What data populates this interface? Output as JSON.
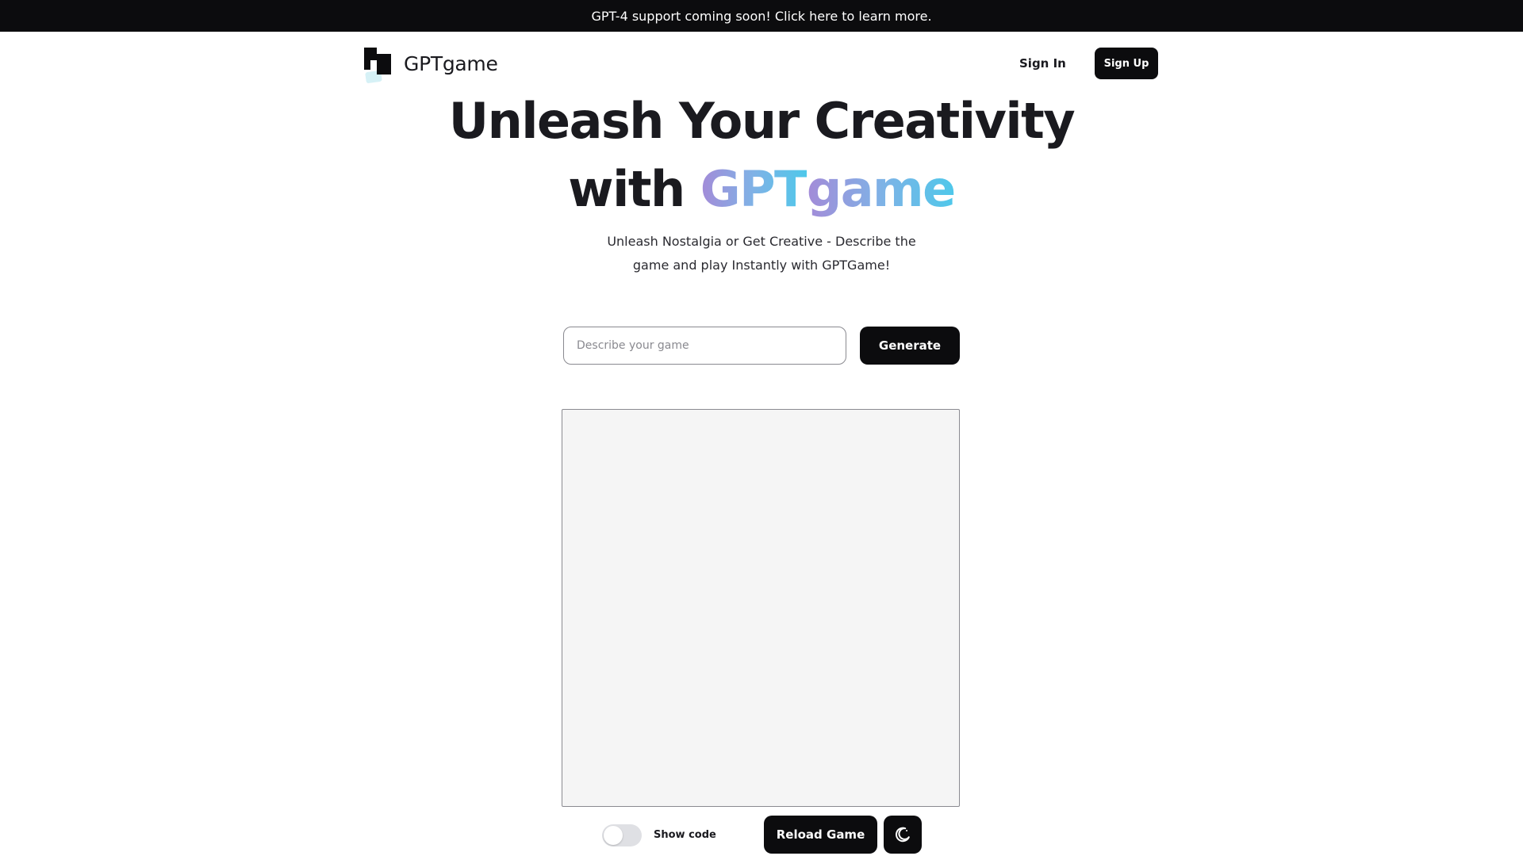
{
  "announcement": {
    "text": "GPT-4 support coming soon! Click here to learn more."
  },
  "header": {
    "brand": "GPTgame",
    "signin_label": "Sign In",
    "signup_label": "Sign Up"
  },
  "hero": {
    "line1": "Unleash Your Creativity",
    "line2_prefix": "with ",
    "gradient_part1": "GPT",
    "gradient_part2": "game",
    "subtitle": "Unleash Nostalgia or Get Creative - Describe the game and play Instantly with GPTGame!",
    "gradient_colors": [
      "#a38bd8",
      "#7fb2e6",
      "#4ec8ea"
    ]
  },
  "prompt": {
    "placeholder": "Describe your game",
    "value": "",
    "generate_label": "Generate"
  },
  "controls": {
    "show_code_label": "Show code",
    "show_code_on": false,
    "reload_label": "Reload Game",
    "theme_icon": "moon-icon"
  },
  "colors": {
    "primary": "#0c0c0e",
    "frame_bg": "#f5f5f5",
    "toggle_off": "#dfe0e4"
  }
}
